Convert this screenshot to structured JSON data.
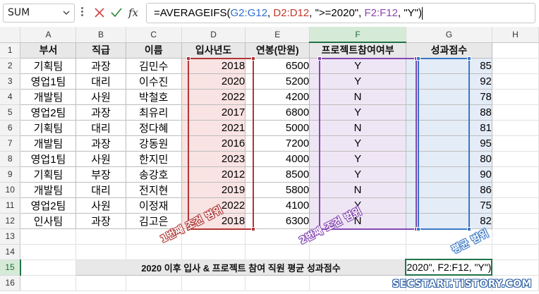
{
  "formula_bar": {
    "name_box": "SUM",
    "formula_parts": [
      "=AVERAGEIFS(",
      "G2:G12",
      ", ",
      "D2:D12",
      ", \">=2020\", ",
      "F2:F12",
      ", \"Y\")"
    ],
    "fx_label": "fx"
  },
  "columns": [
    "A",
    "B",
    "C",
    "D",
    "E",
    "F",
    "G",
    "H"
  ],
  "rows": [
    "1",
    "2",
    "3",
    "4",
    "5",
    "6",
    "7",
    "8",
    "9",
    "10",
    "11",
    "12",
    "13",
    "14",
    "15",
    "16"
  ],
  "headers": [
    "부서",
    "직급",
    "이름",
    "입사년도",
    "연봉(만원)",
    "프로젝트참여여부",
    "성과점수"
  ],
  "table": [
    [
      "기획팀",
      "과장",
      "김민수",
      "2018",
      "6500",
      "Y",
      "85"
    ],
    [
      "영업1팀",
      "대리",
      "이수진",
      "2020",
      "5200",
      "Y",
      "92"
    ],
    [
      "개발팀",
      "사원",
      "박철호",
      "2022",
      "4200",
      "N",
      "78"
    ],
    [
      "영업2팀",
      "과장",
      "최유리",
      "2017",
      "6800",
      "Y",
      "88"
    ],
    [
      "기획팀",
      "대리",
      "정다혜",
      "2021",
      "5000",
      "N",
      "81"
    ],
    [
      "개발팀",
      "과장",
      "강동원",
      "2016",
      "7200",
      "Y",
      "95"
    ],
    [
      "영업1팀",
      "사원",
      "한지민",
      "2023",
      "4000",
      "Y",
      "80"
    ],
    [
      "기획팀",
      "부장",
      "송강호",
      "2012",
      "8500",
      "Y",
      "90"
    ],
    [
      "개발팀",
      "대리",
      "전지현",
      "2019",
      "5800",
      "N",
      "86"
    ],
    [
      "영업2팀",
      "사원",
      "이정재",
      "2022",
      "4100",
      "Y",
      "75"
    ],
    [
      "인사팀",
      "과장",
      "김고은",
      "2018",
      "6300",
      "N",
      "82"
    ]
  ],
  "summary": {
    "label": "2020 이후 입사 & 프로젝트 참여 직원 평균 성과점수",
    "active_cell_text": "2020\", F2:F12, \"Y\")"
  },
  "annotations": {
    "range1": "1번째 조건 범위",
    "range2": "2번째 조건 범위",
    "avg_range": "평균 범위",
    "watermark": "SECSTART.TISTORY.COM"
  },
  "colors": {
    "range1": "#b03636",
    "range2": "#8548b0",
    "avg_range": "#3a78c4",
    "selection": "#217346"
  }
}
